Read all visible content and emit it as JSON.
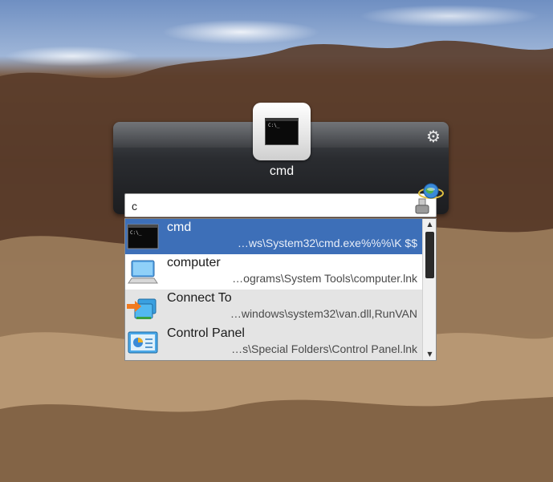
{
  "launcher": {
    "app_name": "cmd",
    "tile_screen_text": "C:\\_"
  },
  "search": {
    "value": "c"
  },
  "results": [
    {
      "title": "cmd",
      "path": "…ws\\System32\\cmd.exe%%%\\K $$",
      "icon": "command-prompt-icon",
      "selected": true
    },
    {
      "title": "computer",
      "path": "…ograms\\System Tools\\computer.lnk",
      "icon": "computer-icon",
      "selected": false
    },
    {
      "title": "Connect To",
      "path": "…windows\\system32\\van.dll,RunVAN",
      "icon": "network-connections-icon",
      "selected": false
    },
    {
      "title": "Control Panel",
      "path": "…s\\Special Folders\\Control Panel.lnk",
      "icon": "control-panel-icon",
      "selected": false
    }
  ],
  "colors": {
    "selection": "#3d6fb8",
    "panel_dark": "#1c1d20",
    "alt_row": "#e4e4e4"
  }
}
